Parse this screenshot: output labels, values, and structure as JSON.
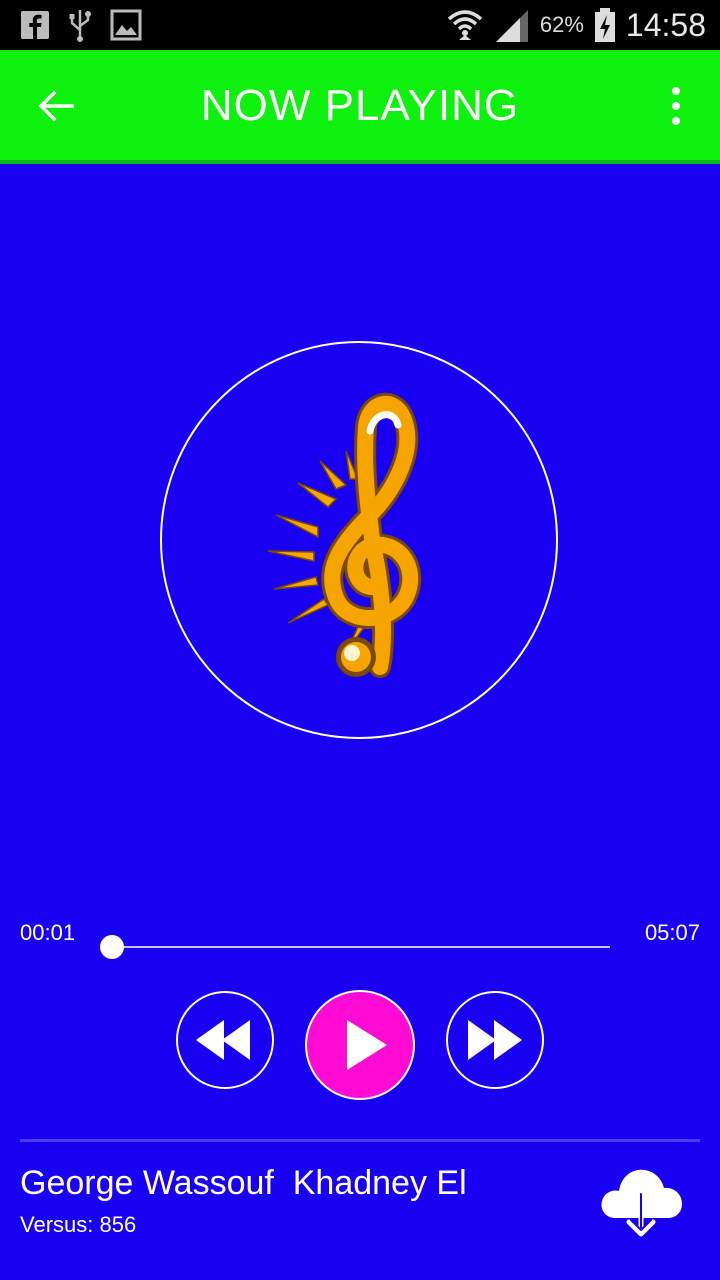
{
  "status_bar": {
    "battery_percent": "62%",
    "time": "14:58",
    "left_icons": [
      "facebook-icon",
      "usb-icon",
      "image-icon"
    ],
    "right_icons": [
      "wifi-icon",
      "signal-icon",
      "battery-charging-icon"
    ]
  },
  "app_bar": {
    "title": "NOW PLAYING",
    "back_icon": "arrow-left-icon",
    "menu_icon": "more-vertical-icon",
    "color": "#0ef00e"
  },
  "album_art": {
    "icon": "treble-clef-icon"
  },
  "player": {
    "current_time": "00:01",
    "duration": "05:07",
    "progress_fraction": 0.003,
    "controls": [
      "rewind",
      "play",
      "fast-forward"
    ],
    "play_color": "#ff0bd4",
    "background": "#1a00f0"
  },
  "track": {
    "title": "George Wassouf  Khadney El",
    "subtitle": "Versus: 856",
    "download_icon": "cloud-download-icon"
  }
}
